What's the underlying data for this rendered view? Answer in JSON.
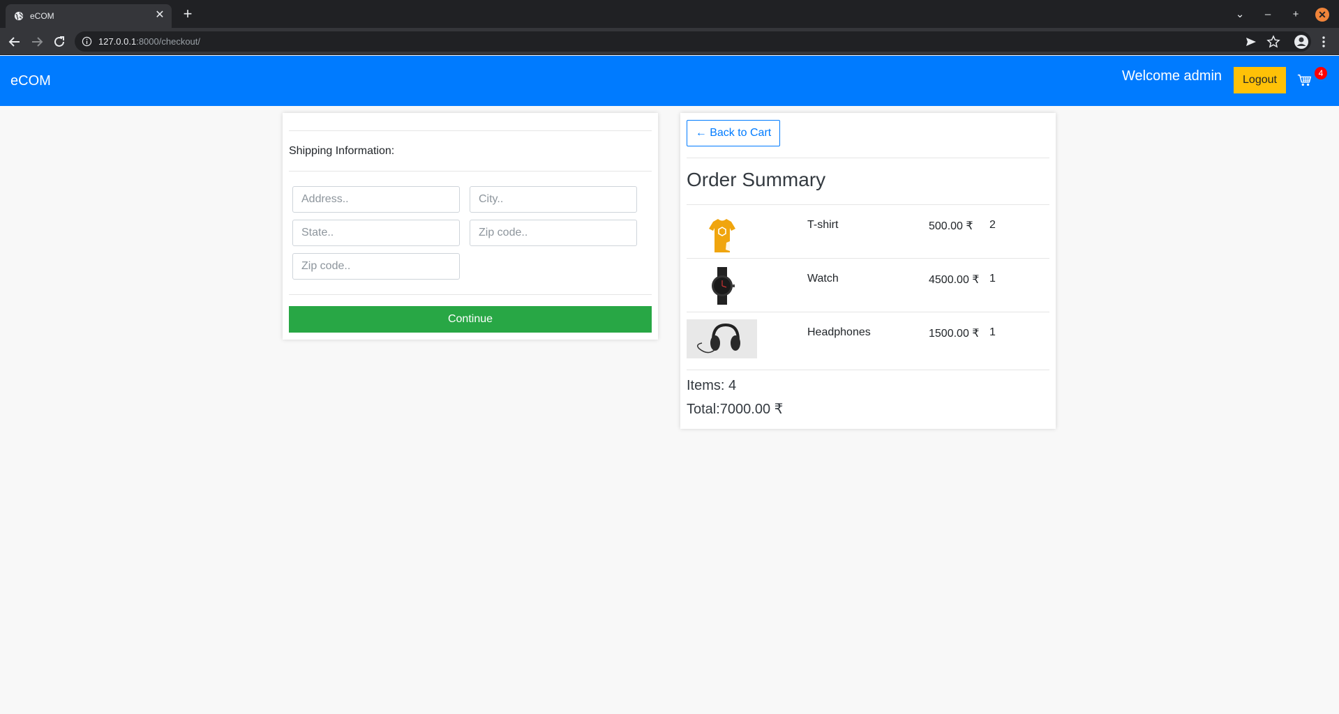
{
  "browser": {
    "tab_title": "eCOM",
    "url_host": "127.0.0.1",
    "url_rest": ":8000/checkout/"
  },
  "navbar": {
    "brand": "eCOM",
    "welcome": "Welcome admin",
    "logout_label": "Logout",
    "cart_count": "4",
    "background": "#007bff"
  },
  "shipping": {
    "title": "Shipping Information:",
    "address_placeholder": "Address..",
    "city_placeholder": "City..",
    "state_placeholder": "State..",
    "zip_placeholder": "Zip code..",
    "zip2_placeholder": "Zip code..",
    "continue_label": "Continue"
  },
  "summary": {
    "back_label": "← Back to Cart",
    "title": "Order Summary",
    "items": [
      {
        "name": "T-shirt",
        "price": "500.00 ₹",
        "qty": "2",
        "image": "tshirt-image"
      },
      {
        "name": "Watch",
        "price": "4500.00 ₹",
        "qty": "1",
        "image": "watch-image"
      },
      {
        "name": "Headphones",
        "price": "1500.00 ₹",
        "qty": "1",
        "image": "headphones-image"
      }
    ],
    "items_text": "Items: 4",
    "total_text": "Total:7000.00 ₹"
  },
  "colors": {
    "primary": "#007bff",
    "success": "#28a745",
    "warning": "#ffc107",
    "badge": "#ff0000"
  }
}
